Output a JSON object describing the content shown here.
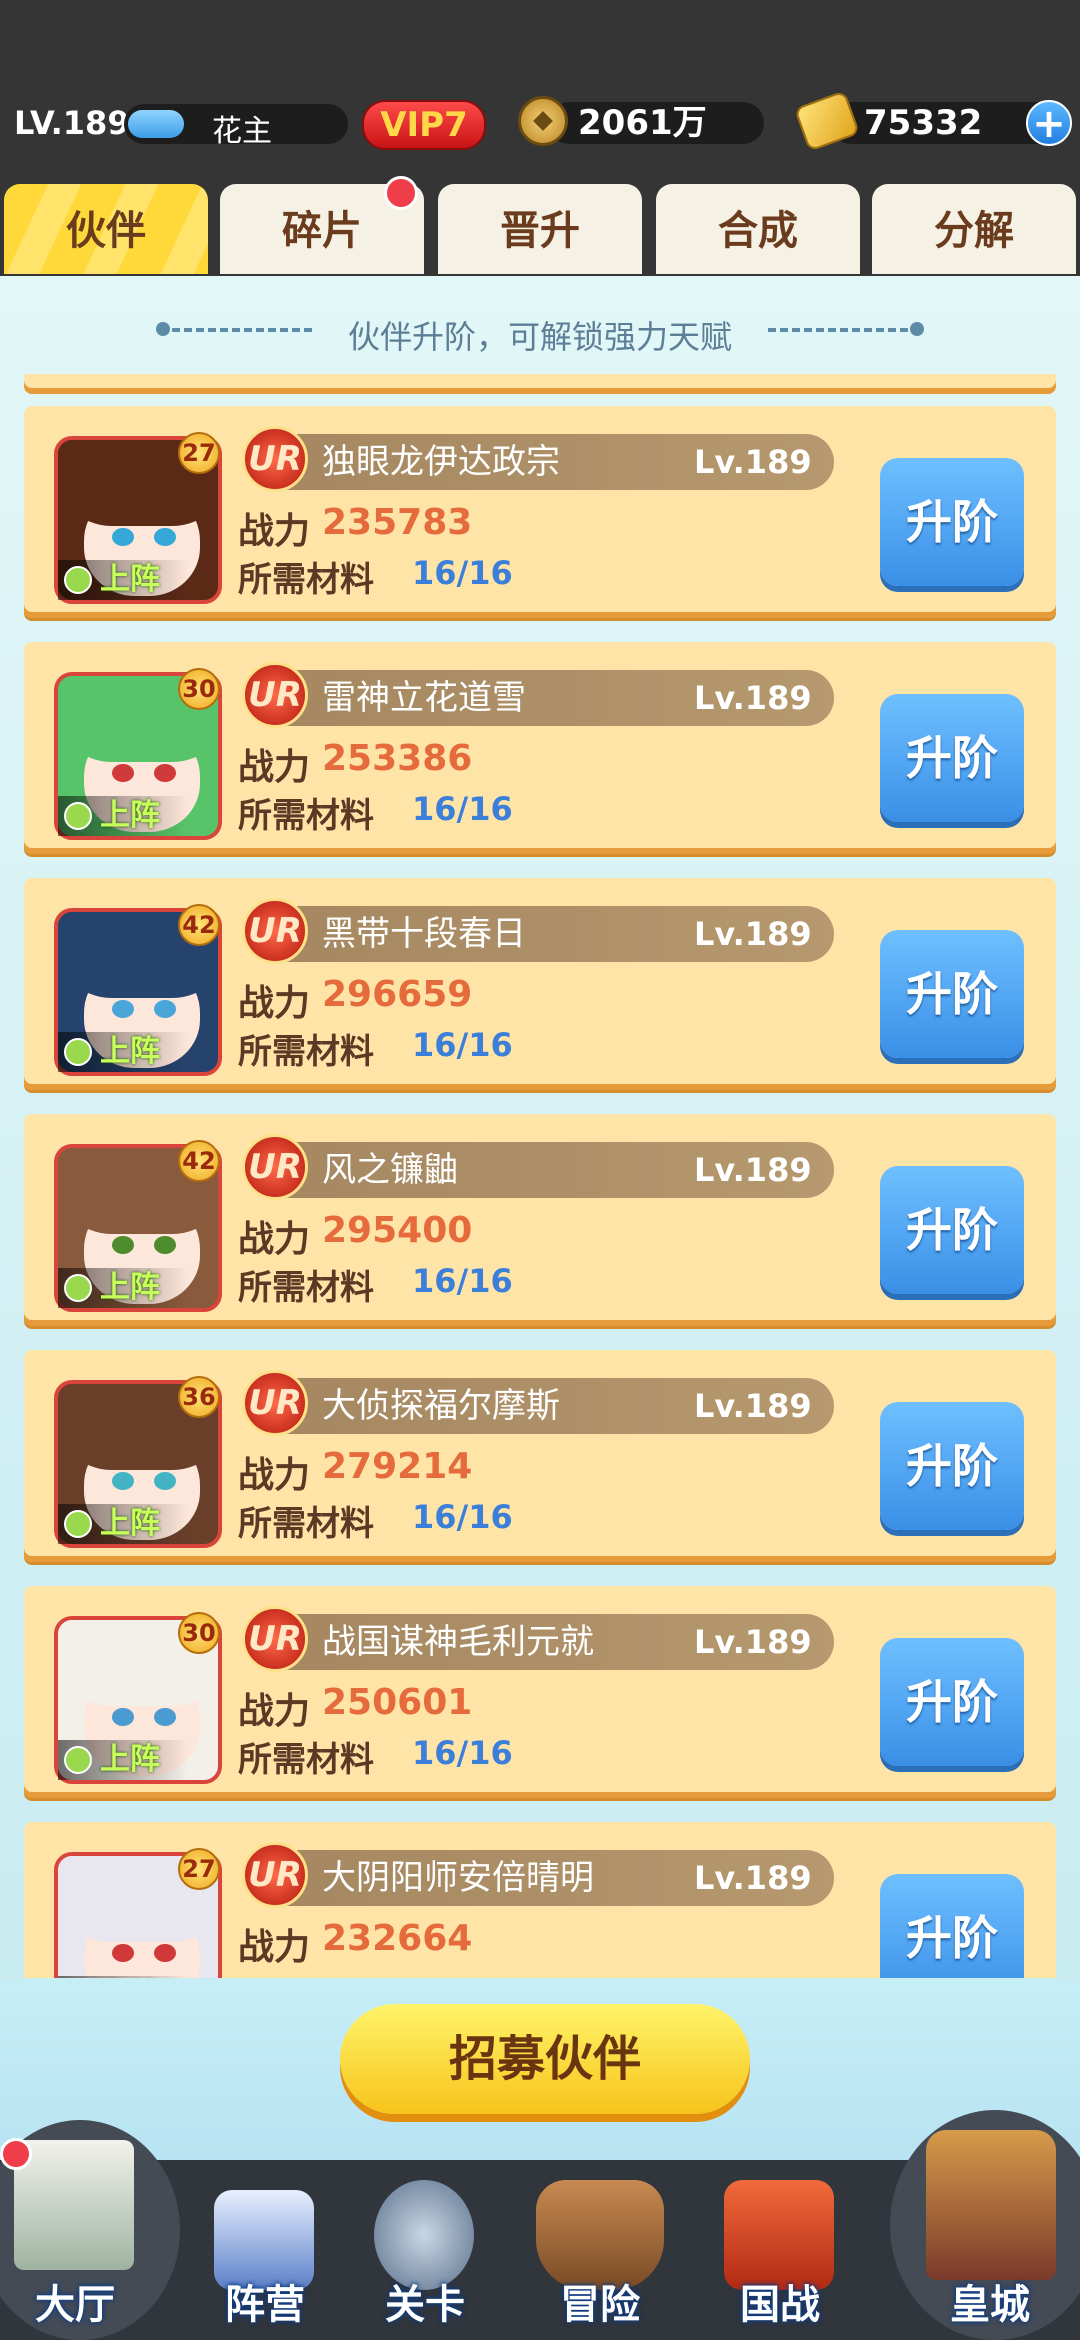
{
  "player": {
    "level": "LV.189",
    "name": "花主",
    "vip": "VIP7",
    "coins": "2061万",
    "ingots": "75332",
    "plus": "+"
  },
  "tabs": [
    {
      "label": "伙伴",
      "active": true
    },
    {
      "label": "碎片",
      "badge": true
    },
    {
      "label": "晋升"
    },
    {
      "label": "合成"
    },
    {
      "label": "分解"
    }
  ],
  "hint": "伙伴升阶，可解锁强力天赋",
  "labels": {
    "power": "战力",
    "materials": "所需材料",
    "upgrade": "升阶",
    "deployed": "上阵",
    "rarity": "UR"
  },
  "heroes": [
    {
      "name": "独眼龙伊达政宗",
      "lv": "Lv.189",
      "star": "27",
      "power": "235783",
      "materials": "16/16",
      "hair": "#5a2a16",
      "eye": "#35a7d9"
    },
    {
      "name": "雷神立花道雪",
      "lv": "Lv.189",
      "star": "30",
      "power": "253386",
      "materials": "16/16",
      "hair": "#58c46a",
      "eye": "#d0393a"
    },
    {
      "name": "黑带十段春日",
      "lv": "Lv.189",
      "star": "42",
      "power": "296659",
      "materials": "16/16",
      "hair": "#26436e",
      "eye": "#4aa6d8"
    },
    {
      "name": "风之镰鼬",
      "lv": "Lv.189",
      "star": "42",
      "power": "295400",
      "materials": "16/16",
      "hair": "#8a5a3c",
      "eye": "#4c8c2c"
    },
    {
      "name": "大侦探福尔摩斯",
      "lv": "Lv.189",
      "star": "36",
      "power": "279214",
      "materials": "16/16",
      "hair": "#6a3f2a",
      "eye": "#43b4c4"
    },
    {
      "name": "战国谋神毛利元就",
      "lv": "Lv.189",
      "star": "30",
      "power": "250601",
      "materials": "16/16",
      "hair": "#f3efe9",
      "eye": "#4a9bd0"
    },
    {
      "name": "大阴阳师安倍晴明",
      "lv": "Lv.189",
      "star": "27",
      "power": "232664",
      "materials": "",
      "hair": "#e8e6ee",
      "eye": "#d0393a"
    }
  ],
  "recruit": "招募伙伴",
  "nav": [
    "大厅",
    "阵营",
    "关卡",
    "冒险",
    "国战",
    "皇城"
  ]
}
